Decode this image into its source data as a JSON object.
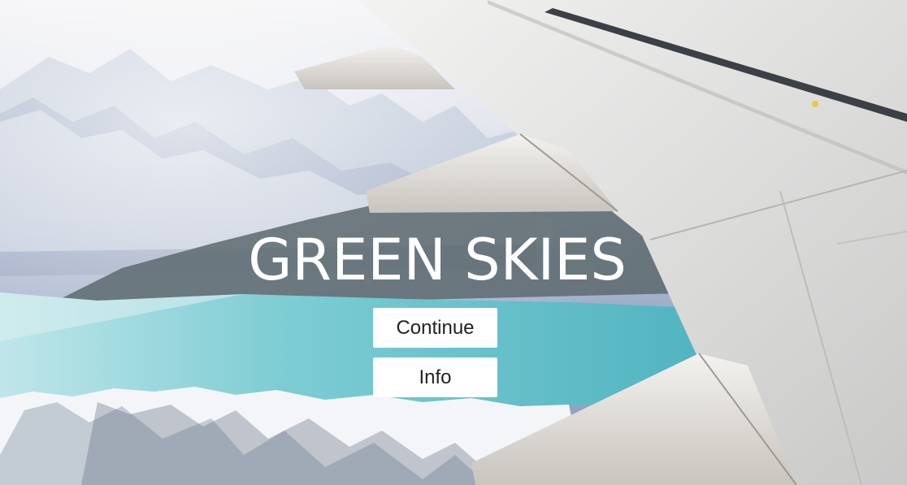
{
  "hero": {
    "title": "GREEN SKIES",
    "background": "airplane-wing-over-mountains-and-lake"
  },
  "buttons": {
    "continue_label": "Continue",
    "info_label": "Info"
  },
  "colors": {
    "title_text": "#ffffff",
    "button_bg": "#ffffff",
    "button_text": "#222222",
    "lake": "#6cc6cf",
    "wing": "#e4e4e2"
  }
}
